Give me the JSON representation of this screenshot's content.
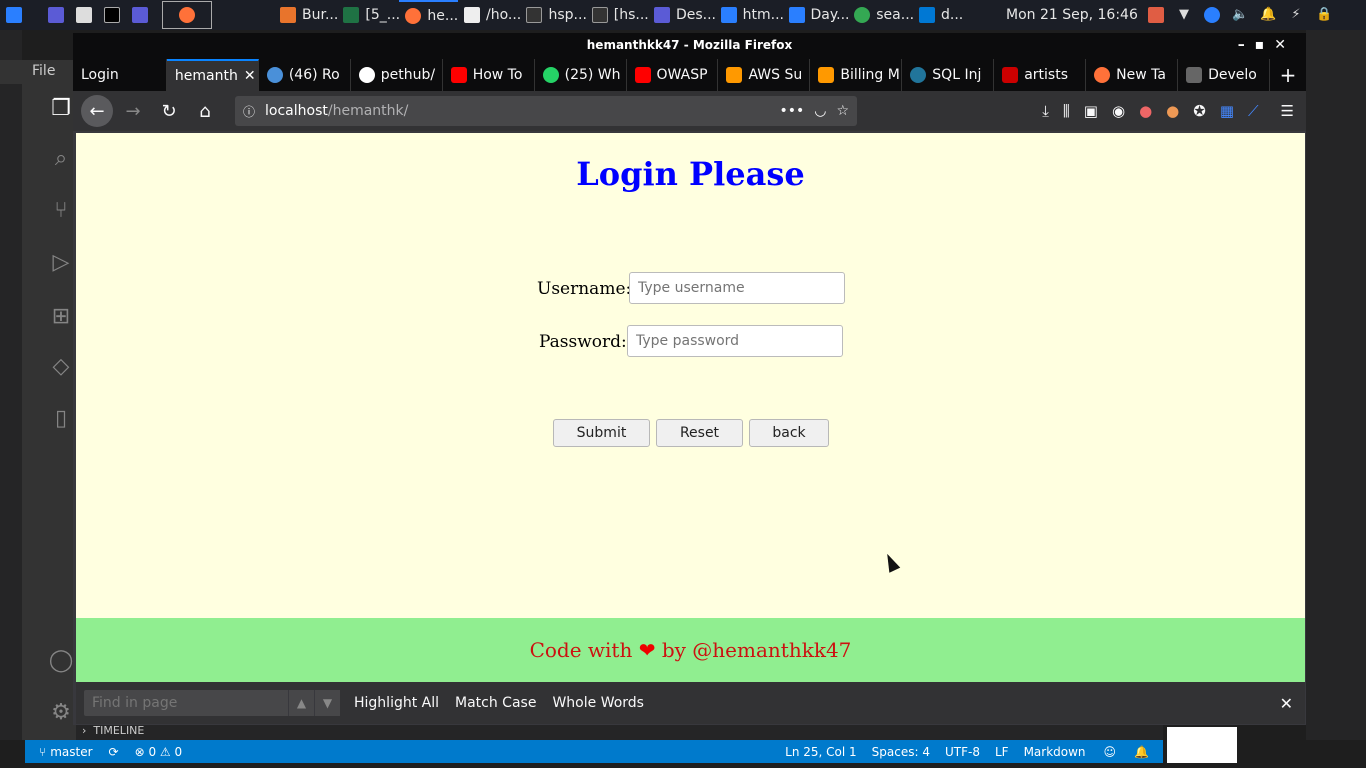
{
  "taskbar": {
    "items": [
      "Bur...",
      "[5_...",
      "he...",
      "/ho...",
      "hsp...",
      "[hs...",
      "Des...",
      "htm...",
      "Day...",
      "sea...",
      "d..."
    ],
    "clock": "Mon 21 Sep, 16:46"
  },
  "vscode": {
    "menu": "File",
    "status": {
      "branch": "master",
      "problems": "⊗ 0 ⚠ 0",
      "position": "Ln 25, Col 1",
      "spaces": "Spaces: 4",
      "encoding": "UTF-8",
      "eol": "LF",
      "language": "Markdown"
    },
    "timeline": "TIMELINE"
  },
  "firefox": {
    "window_title": "hemanthkk47 - Mozilla Firefox",
    "tabs": [
      {
        "label": "Login",
        "color": "#323234"
      },
      {
        "label": "hemanth",
        "color": "#323234"
      },
      {
        "label": "(46) Ro",
        "color": "#4a90d9"
      },
      {
        "label": "pethub/",
        "color": "#ffffff"
      },
      {
        "label": "How To",
        "color": "#ff0000"
      },
      {
        "label": "(25) Wh",
        "color": "#25d366"
      },
      {
        "label": "OWASP",
        "color": "#ff0000"
      },
      {
        "label": "AWS Su",
        "color": "#ff9900"
      },
      {
        "label": "Billing M",
        "color": "#ff9900"
      },
      {
        "label": "SQL Inj",
        "color": "#21759b"
      },
      {
        "label": "artists",
        "color": "#cc0000"
      },
      {
        "label": "New Ta",
        "color": "#ff7139"
      },
      {
        "label": "Develo",
        "color": "#888888"
      }
    ],
    "url_host": "localhost",
    "url_path": "/hemanthk/"
  },
  "page": {
    "heading": "Login Please",
    "username_label": "Username:",
    "username_placeholder": "Type username",
    "password_label": "Password:",
    "password_placeholder": "Type password",
    "submit": "Submit",
    "reset": "Reset",
    "back": "back",
    "footer_pre": "Code with",
    "footer_post": "by @hemanthkk47"
  },
  "findbar": {
    "placeholder": "Find in page",
    "highlight_all": "Highlight All",
    "match_case": "Match Case",
    "whole_words": "Whole Words"
  }
}
